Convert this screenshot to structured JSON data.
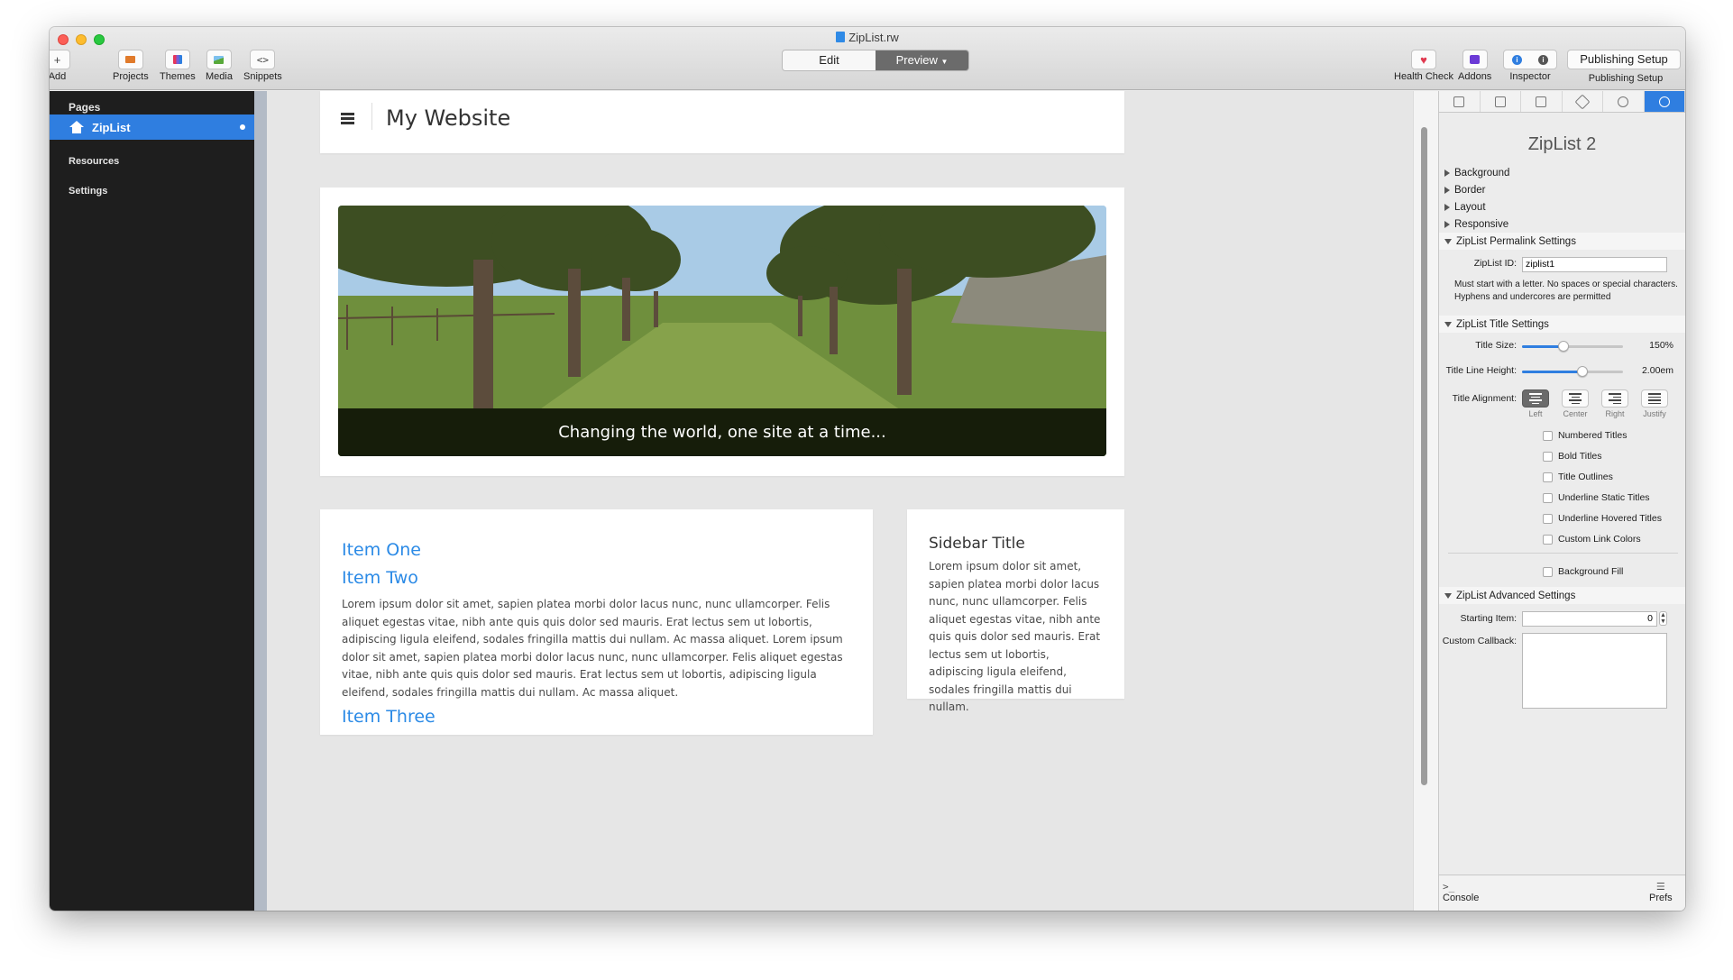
{
  "window": {
    "title": "ZipList.rw"
  },
  "toolbar": {
    "add": "Add",
    "projects": "Projects",
    "themes": "Themes",
    "media": "Media",
    "snippets": "Snippets",
    "mode_edit": "Edit",
    "mode_preview": "Preview",
    "health_check": "Health Check",
    "addons": "Addons",
    "inspector": "Inspector",
    "publishing_setup_button": "Publishing Setup",
    "publishing_setup_label": "Publishing Setup"
  },
  "sidebar": {
    "pages_heading": "Pages",
    "active_page": "ZipList",
    "resources": "Resources",
    "settings": "Settings"
  },
  "site": {
    "title": "My Website",
    "hero_caption": "Changing the world, one site at a time...",
    "items": [
      {
        "title": "Item One"
      },
      {
        "title": "Item Two",
        "body": "Lorem ipsum dolor sit amet, sapien platea morbi dolor lacus nunc, nunc ullamcorper. Felis aliquet egestas vitae, nibh ante quis quis dolor sed mauris. Erat lectus sem ut lobortis, adipiscing ligula eleifend, sodales fringilla mattis dui nullam. Ac massa aliquet. Lorem ipsum dolor sit amet, sapien platea morbi dolor lacus nunc, nunc ullamcorper. Felis aliquet egestas vitae, nibh ante quis quis dolor sed mauris. Erat lectus sem ut lobortis, adipiscing ligula eleifend, sodales fringilla mattis dui nullam. Ac massa aliquet."
      },
      {
        "title": "Item Three"
      }
    ],
    "sidebar_title": "Sidebar Title",
    "sidebar_body": "Lorem ipsum dolor sit amet, sapien platea morbi dolor lacus nunc, nunc ullamcorper. Felis aliquet egestas vitae, nibh ante quis quis dolor sed mauris. Erat lectus sem ut lobortis, adipiscing ligula eleifend, sodales fringilla mattis dui nullam."
  },
  "inspector": {
    "title": "ZipList 2",
    "sections": {
      "background": "Background",
      "border": "Border",
      "layout": "Layout",
      "responsive": "Responsive",
      "permalink": "ZipList Permalink Settings",
      "title_settings": "ZipList Title Settings",
      "advanced": "ZipList Advanced Settings"
    },
    "ziplist_id_label": "ZipList ID:",
    "ziplist_id_value": "ziplist1",
    "id_help": "Must start with a letter. No spaces or special characters. Hyphens and undercores are permitted",
    "title_size_label": "Title Size:",
    "title_size_value": "150%",
    "title_size_level": 0.41,
    "title_line_height_label": "Title Line Height:",
    "title_line_height_value": "2.00em",
    "title_line_height_level": 0.6,
    "title_alignment_label": "Title Alignment:",
    "alignments": [
      "Left",
      "Center",
      "Right",
      "Justify"
    ],
    "selected_alignment": "Left",
    "checkboxes": [
      "Numbered Titles",
      "Bold Titles",
      "Title Outlines",
      "Underline Static Titles",
      "Underline Hovered Titles",
      "Custom Link Colors"
    ],
    "background_fill": "Background Fill",
    "starting_item_label": "Starting Item:",
    "starting_item_value": "0",
    "custom_callback_label": "Custom Callback:",
    "console": "Console",
    "prefs": "Prefs"
  },
  "colors": {
    "accent": "#2f7ee0",
    "link": "#2b8ae6",
    "sidebar_bg": "#1e1e1e"
  }
}
